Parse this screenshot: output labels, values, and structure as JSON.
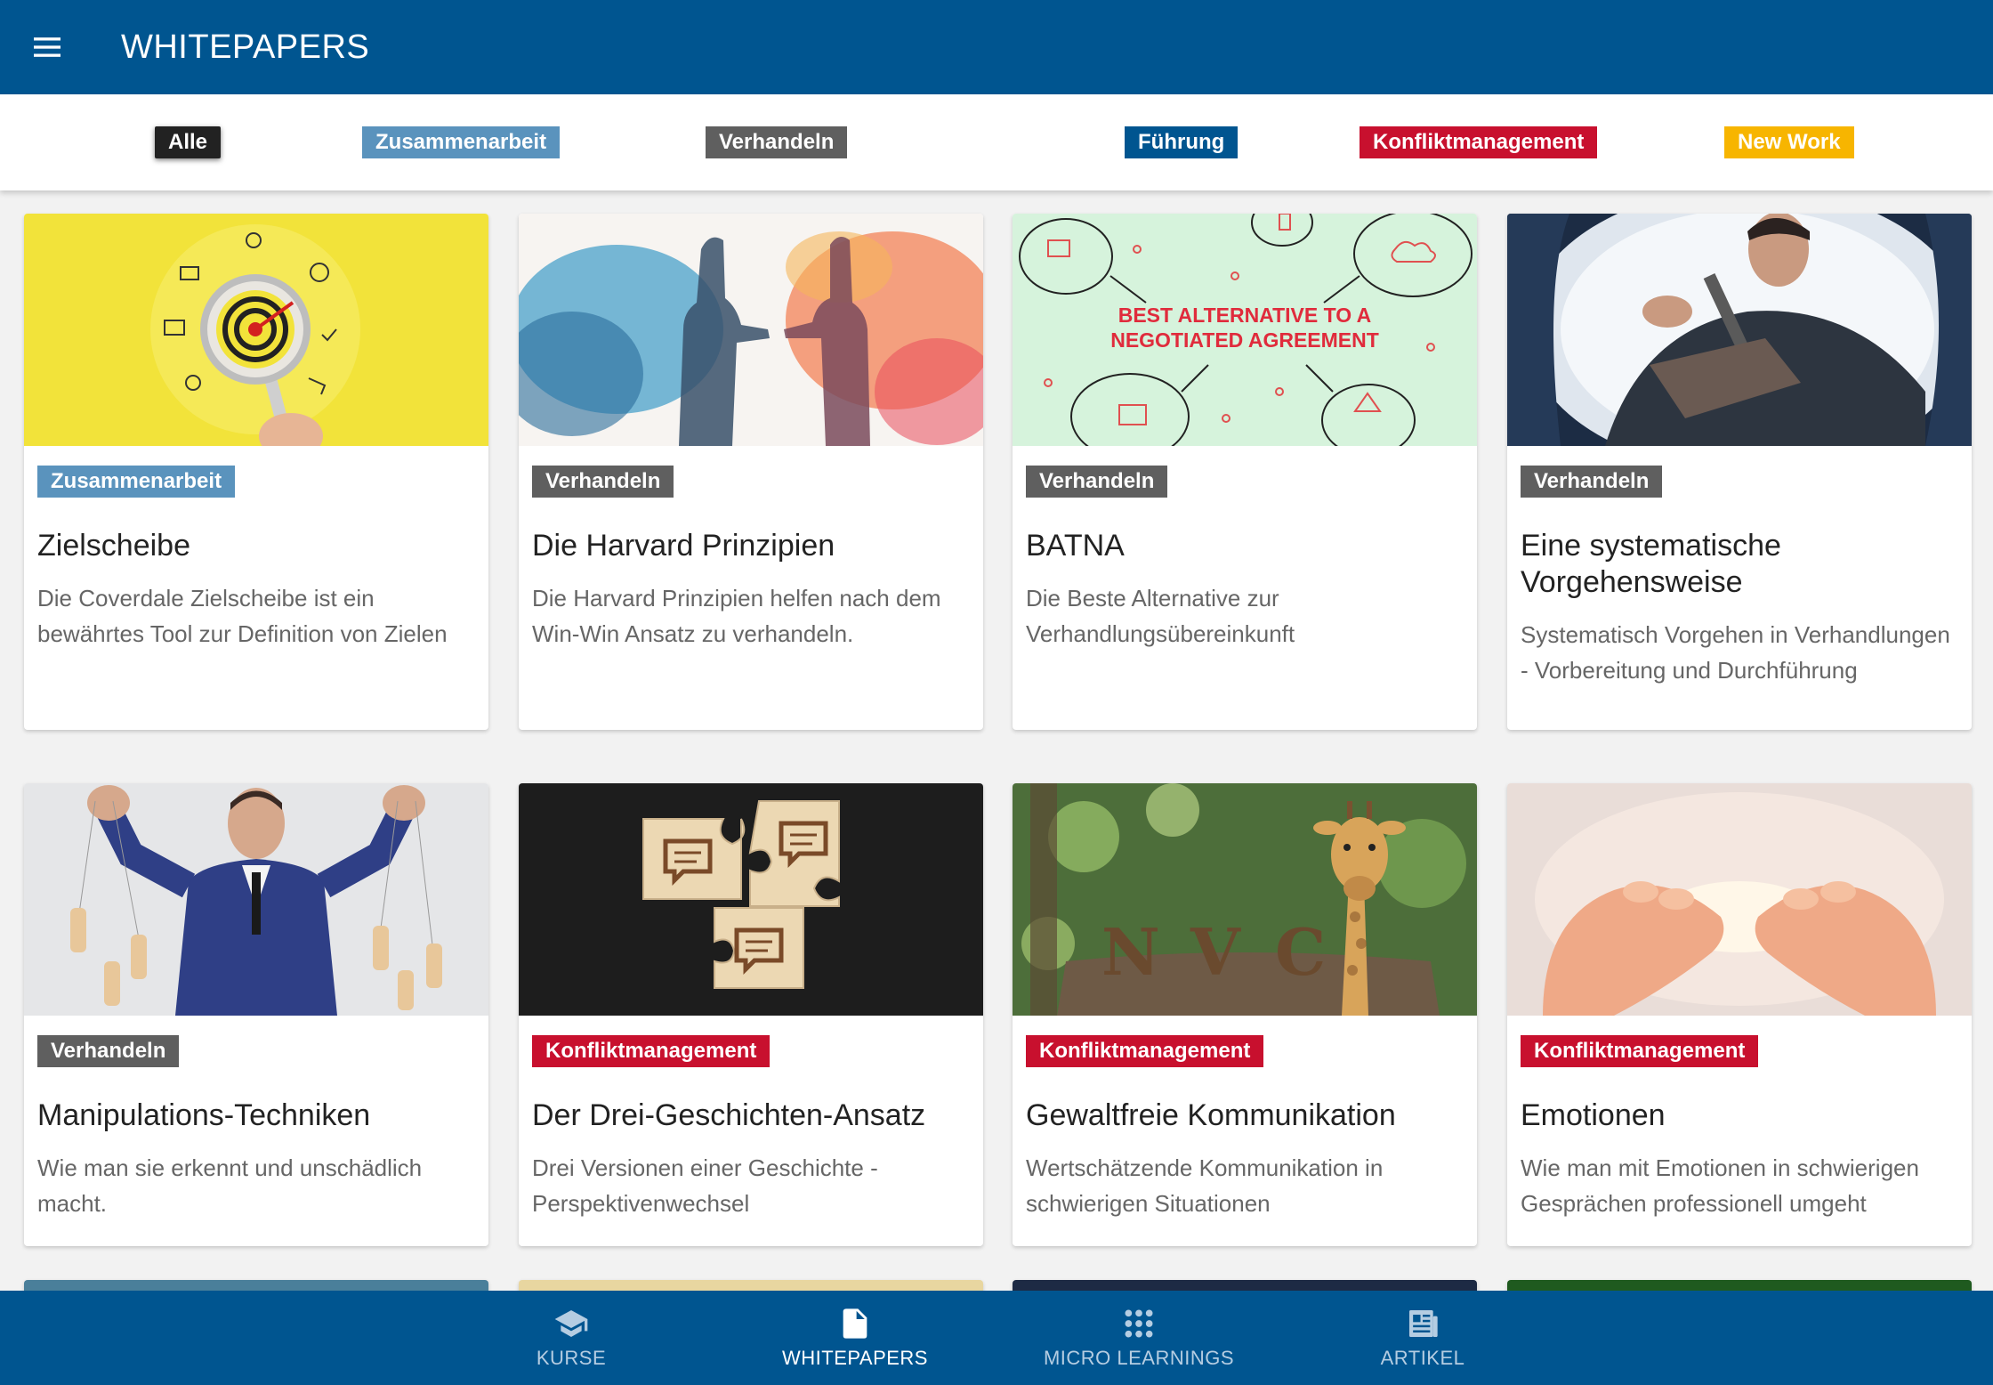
{
  "header": {
    "title": "WHITEPAPERS"
  },
  "filters": [
    {
      "label": "Alle",
      "color": "#222222"
    },
    {
      "label": "Zusammenarbeit",
      "color": "#5a93bd"
    },
    {
      "label": "Verhandeln",
      "color": "#5f5f5f"
    },
    {
      "label": "Führung",
      "color": "#005590"
    },
    {
      "label": "Konfliktmanagement",
      "color": "#c8102e"
    },
    {
      "label": "New Work",
      "color": "#f7b500"
    }
  ],
  "cards": [
    {
      "category": "Zusammenarbeit",
      "category_color": "#5a93bd",
      "title": "Zielscheibe",
      "description": "Die Coverdale Zielscheibe ist ein bewährtes Tool zur Definition von Zielen",
      "image": "target-magnifier-image"
    },
    {
      "category": "Verhandeln",
      "category_color": "#5f5f5f",
      "title": "Die Harvard Prinzipien",
      "description": "Die Harvard Prinzipien helfen nach dem Win-Win Ansatz zu verhandeln.",
      "image": "handshake-watercolor-image"
    },
    {
      "category": "Verhandeln",
      "category_color": "#5f5f5f",
      "title": "BATNA",
      "description": "Die Beste Alternative zur Verhandlungsübereinkunft",
      "image": "batna-diagram-image",
      "image_text": [
        "BEST ALTERNATIVE TO A",
        "NEGOTIATED AGREEMENT"
      ]
    },
    {
      "category": "Verhandeln",
      "category_color": "#5f5f5f",
      "title": "Eine systematische Vorgehensweise",
      "description": "Systematisch Vorgehen in Verhandlungen - Vorbereitung und Durchführung",
      "image": "man-digging-image"
    },
    {
      "category": "Verhandeln",
      "category_color": "#5f5f5f",
      "title": "Manipulations-Techniken",
      "description": "Wie man sie erkennt und unschädlich macht.",
      "image": "puppet-master-image"
    },
    {
      "category": "Konfliktmanagement",
      "category_color": "#c8102e",
      "title": "Der Drei-Geschichten-Ansatz",
      "description": "Drei Versionen einer Geschichte - Perspektivenwechsel",
      "image": "puzzle-speech-bubbles-image"
    },
    {
      "category": "Konfliktmanagement",
      "category_color": "#c8102e",
      "title": "Gewaltfreie Kommunikation",
      "description": "Wertschätzende Kommunikation in schwierigen Situationen",
      "image": "giraffe-nvc-image",
      "image_text": [
        "N",
        "V",
        "C"
      ]
    },
    {
      "category": "Konfliktmanagement",
      "category_color": "#c8102e",
      "title": "Emotionen",
      "description": "Wie man mit Emotionen in schwierigen Gesprächen professionell umgeht",
      "image": "open-hands-light-image"
    }
  ],
  "bottom_nav": [
    {
      "label": "KURSE",
      "icon": "graduation-cap-icon",
      "active": false
    },
    {
      "label": "WHITEPAPERS",
      "icon": "document-icon",
      "active": true
    },
    {
      "label": "MICRO LEARNINGS",
      "icon": "grid-dots-icon",
      "active": false
    },
    {
      "label": "ARTIKEL",
      "icon": "newspaper-icon",
      "active": false
    }
  ]
}
